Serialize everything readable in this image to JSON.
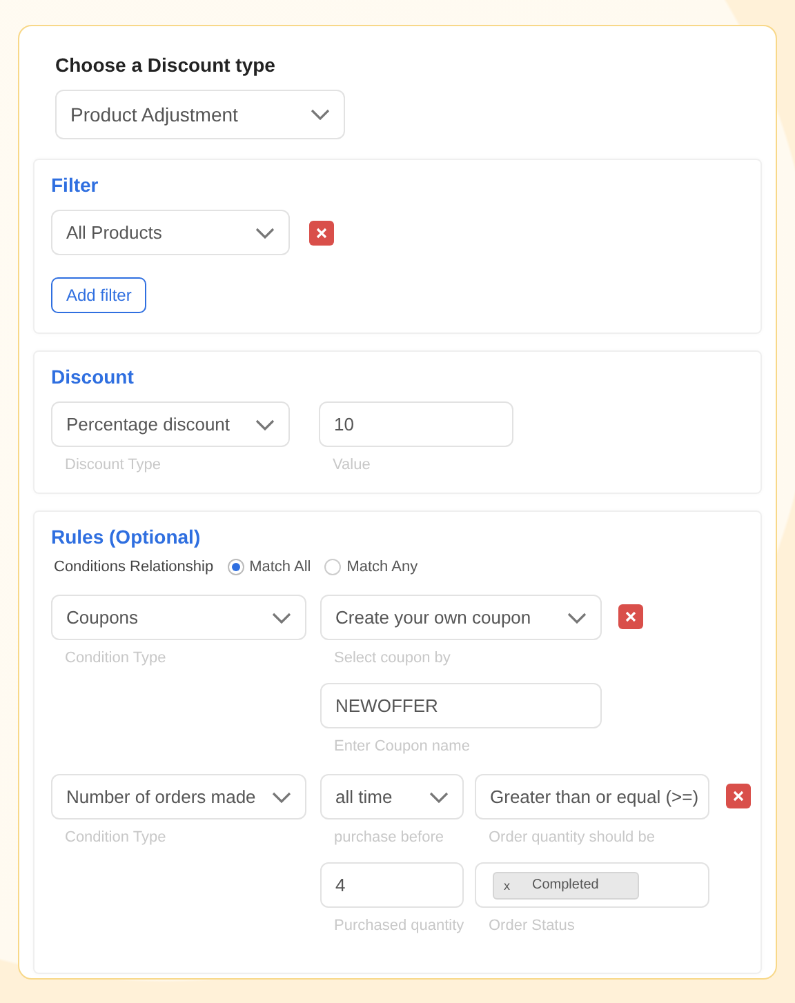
{
  "discount_type": {
    "label": "Choose a Discount type",
    "value": "Product Adjustment"
  },
  "filter": {
    "title": "Filter",
    "filters": [
      {
        "value": "All Products"
      }
    ],
    "add_button": "Add filter"
  },
  "discount": {
    "title": "Discount",
    "fields": [
      {
        "kind": "select",
        "value": "Percentage discount",
        "caption": "Discount Type"
      },
      {
        "kind": "input",
        "value": "10",
        "caption": "Value"
      }
    ]
  },
  "rules": {
    "title": "Rules (Optional)",
    "relationship_label": "Conditions Relationship",
    "options": [
      {
        "label": "Match All",
        "selected": true
      },
      {
        "label": "Match Any",
        "selected": false
      }
    ],
    "conditions": [
      {
        "condition": {
          "kind": "select",
          "value": "Coupons",
          "caption": "Condition Type"
        },
        "lines": [
          [
            {
              "kind": "select",
              "value": "Create your own coupon",
              "caption": "Select coupon by"
            }
          ],
          [
            {
              "kind": "input",
              "value": "NEWOFFER",
              "caption": "Enter Coupon name"
            }
          ]
        ]
      },
      {
        "condition": {
          "kind": "select",
          "value": "Number of orders made",
          "caption": "Condition Type"
        },
        "lines": [
          [
            {
              "kind": "select",
              "value": "all time",
              "caption": "purchase before"
            },
            {
              "kind": "input",
              "value": "Greater than or equal (>=)",
              "caption": "Order quantity should be"
            }
          ],
          [
            {
              "kind": "input",
              "value": "4",
              "caption": "Purchased quantity"
            },
            {
              "kind": "tags",
              "tags": [
                "Completed"
              ],
              "remove_mark": "x",
              "caption": "Order Status"
            }
          ]
        ]
      }
    ]
  }
}
